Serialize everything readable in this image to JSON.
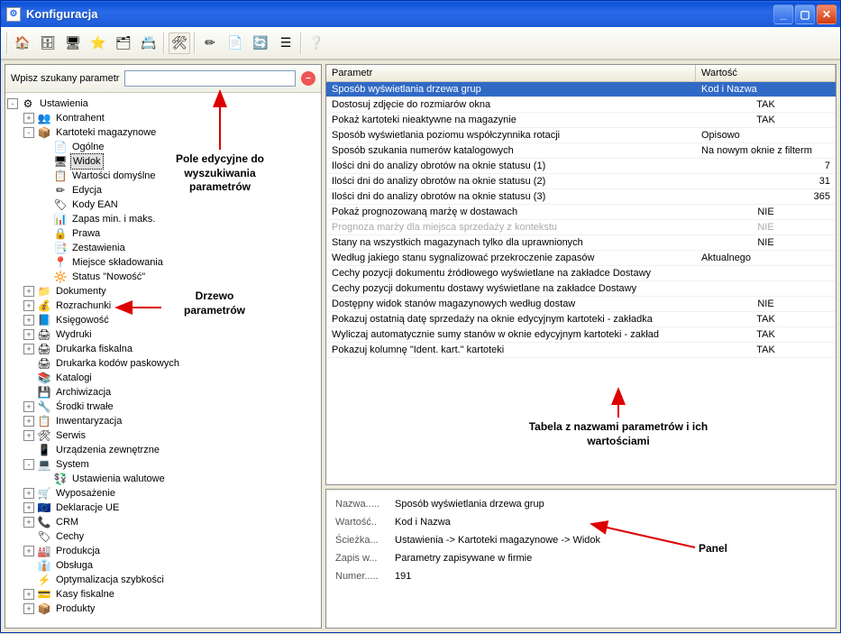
{
  "window": {
    "title": "Konfiguracja"
  },
  "search": {
    "label": "Wpisz szukany parametr",
    "value": ""
  },
  "tree": [
    {
      "depth": 0,
      "pm": "-",
      "icon": "⚙",
      "label": "Ustawienia",
      "sel": false
    },
    {
      "depth": 1,
      "pm": "+",
      "icon": "👥",
      "label": "Kontrahent"
    },
    {
      "depth": 1,
      "pm": "-",
      "icon": "📦",
      "label": "Kartoteki magazynowe"
    },
    {
      "depth": 2,
      "pm": " ",
      "icon": "📄",
      "label": "Ogólne"
    },
    {
      "depth": 2,
      "pm": " ",
      "icon": "🖥",
      "label": "Widok",
      "sel": true
    },
    {
      "depth": 2,
      "pm": " ",
      "icon": "📋",
      "label": "Wartości domyślne"
    },
    {
      "depth": 2,
      "pm": " ",
      "icon": "✏",
      "label": "Edycja"
    },
    {
      "depth": 2,
      "pm": " ",
      "icon": "🏷",
      "label": "Kody EAN"
    },
    {
      "depth": 2,
      "pm": " ",
      "icon": "📊",
      "label": "Zapas min. i maks."
    },
    {
      "depth": 2,
      "pm": " ",
      "icon": "🔒",
      "label": "Prawa"
    },
    {
      "depth": 2,
      "pm": " ",
      "icon": "📑",
      "label": "Zestawienia"
    },
    {
      "depth": 2,
      "pm": " ",
      "icon": "📍",
      "label": "Miejsce składowania"
    },
    {
      "depth": 2,
      "pm": " ",
      "icon": "🔆",
      "label": "Status \"Nowość\""
    },
    {
      "depth": 1,
      "pm": "+",
      "icon": "📁",
      "label": "Dokumenty"
    },
    {
      "depth": 1,
      "pm": "+",
      "icon": "💰",
      "label": "Rozrachunki"
    },
    {
      "depth": 1,
      "pm": "+",
      "icon": "📘",
      "label": "Księgowość"
    },
    {
      "depth": 1,
      "pm": "+",
      "icon": "🖨",
      "label": "Wydruki"
    },
    {
      "depth": 1,
      "pm": "+",
      "icon": "🖨",
      "label": "Drukarka fiskalna"
    },
    {
      "depth": 1,
      "pm": " ",
      "icon": "🖨",
      "label": "Drukarka kodów paskowych"
    },
    {
      "depth": 1,
      "pm": " ",
      "icon": "📚",
      "label": "Katalogi"
    },
    {
      "depth": 1,
      "pm": " ",
      "icon": "💾",
      "label": "Archiwizacja"
    },
    {
      "depth": 1,
      "pm": "+",
      "icon": "🔧",
      "label": "Środki trwałe"
    },
    {
      "depth": 1,
      "pm": "+",
      "icon": "📋",
      "label": "Inwentaryzacja"
    },
    {
      "depth": 1,
      "pm": "+",
      "icon": "🛠",
      "label": "Serwis"
    },
    {
      "depth": 1,
      "pm": " ",
      "icon": "📱",
      "label": "Urządzenia zewnętrzne"
    },
    {
      "depth": 1,
      "pm": "-",
      "icon": "💻",
      "label": "System"
    },
    {
      "depth": 2,
      "pm": " ",
      "icon": "💱",
      "label": "Ustawienia walutowe"
    },
    {
      "depth": 1,
      "pm": "+",
      "icon": "🛒",
      "label": "Wyposażenie"
    },
    {
      "depth": 1,
      "pm": "+",
      "icon": "🇪🇺",
      "label": "Deklaracje UE"
    },
    {
      "depth": 1,
      "pm": "+",
      "icon": "📞",
      "label": "CRM"
    },
    {
      "depth": 1,
      "pm": " ",
      "icon": "🏷",
      "label": "Cechy"
    },
    {
      "depth": 1,
      "pm": "+",
      "icon": "🏭",
      "label": "Produkcja"
    },
    {
      "depth": 1,
      "pm": " ",
      "icon": "👔",
      "label": "Obsługa"
    },
    {
      "depth": 1,
      "pm": " ",
      "icon": "⚡",
      "label": "Optymalizacja szybkości"
    },
    {
      "depth": 1,
      "pm": "+",
      "icon": "💳",
      "label": "Kasy fiskalne"
    },
    {
      "depth": 1,
      "pm": "+",
      "icon": "📦",
      "label": "Produkty"
    }
  ],
  "grid": {
    "head_param": "Parametr",
    "head_value": "Wartość",
    "rows": [
      {
        "p": "Sposób wyświetlania drzewa grup",
        "v": "Kod i Nazwa",
        "align": "left",
        "sel": true
      },
      {
        "p": "Dostosuj zdjęcie do rozmiarów okna",
        "v": "TAK"
      },
      {
        "p": "Pokaż kartoteki nieaktywne na magazynie",
        "v": "TAK"
      },
      {
        "p": "Sposób wyświetlania poziomu współczynnika rotacji",
        "v": "Opisowo",
        "align": "left"
      },
      {
        "p": "Sposób szukania numerów katalogowych",
        "v": "Na nowym oknie z filterm",
        "align": "left"
      },
      {
        "p": "Ilości dni do analizy obrotów na oknie statusu (1)",
        "v": "7",
        "align": "right"
      },
      {
        "p": "Ilości dni do analizy obrotów na oknie statusu (2)",
        "v": "31",
        "align": "right"
      },
      {
        "p": "Ilości dni do analizy obrotów na oknie statusu (3)",
        "v": "365",
        "align": "right"
      },
      {
        "p": "Pokaż prognozowaną marżę w dostawach",
        "v": "NIE"
      },
      {
        "p": "Prognoza marży dla miejsca sprzedaży z kontekstu",
        "v": "NIE",
        "disabled": true
      },
      {
        "p": "Stany na wszystkich magazynach tylko dla uprawnionych",
        "v": "NIE"
      },
      {
        "p": "Według jakiego stanu sygnalizować przekroczenie zapasów",
        "v": "Aktualnego",
        "align": "left"
      },
      {
        "p": "Cechy pozycji dokumentu źródłowego wyświetlane na zakładce Dostawy",
        "v": ""
      },
      {
        "p": "Cechy pozycji dokumentu dostawy wyświetlane na zakładce Dostawy",
        "v": ""
      },
      {
        "p": "Dostępny widok stanów magazynowych według dostaw",
        "v": "NIE"
      },
      {
        "p": "Pokazuj ostatnią datę sprzedaży na oknie edycyjnym kartoteki - zakładka",
        "v": "TAK"
      },
      {
        "p": "Wyliczaj automatycznie sumy stanów w oknie edycyjnym kartoteki - zakład",
        "v": "TAK"
      },
      {
        "p": "Pokazuj kolumnę \"Ident. kart.\" kartoteki",
        "v": "TAK"
      }
    ]
  },
  "detail": {
    "k_name": "Nazwa.....",
    "v_name": "Sposób wyświetlania drzewa grup",
    "k_value": "Wartość..",
    "v_value": "Kod i Nazwa",
    "k_path": "Ścieżka...",
    "v_path": "Ustawienia -> Kartoteki magazynowe -> Widok",
    "k_save": "Zapis w...",
    "v_save": "Parametry zapisywane w firmie",
    "k_num": "Numer.....",
    "v_num": "191"
  },
  "annotations": {
    "a1": "Pole edycyjne do wyszukiwania parametrów",
    "a2": "Drzewo parametrów",
    "a3": "Tabela z nazwami parametrów i ich wartościami",
    "a4": "Panel"
  }
}
